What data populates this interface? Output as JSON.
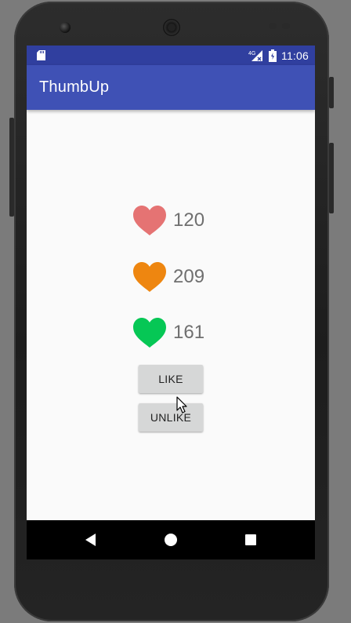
{
  "status_bar": {
    "time": "11:06",
    "network_label": "4G",
    "icons": [
      "sd-card-icon",
      "cell-signal-4g-icon",
      "battery-icon"
    ]
  },
  "app_bar": {
    "title": "ThumbUp"
  },
  "hearts": [
    {
      "count": "120",
      "color": "#e57373",
      "icon": "heart-icon"
    },
    {
      "count": "209",
      "color": "#ee8610",
      "icon": "heart-icon"
    },
    {
      "count": "161",
      "color": "#06c755",
      "icon": "heart-icon"
    }
  ],
  "buttons": {
    "like_label": "LIKE",
    "unlike_label": "UNLIKE"
  },
  "colors": {
    "status_bar": "#303f9f",
    "app_bar": "#3f51b5",
    "background": "#fafafa",
    "button": "#d6d7d7"
  },
  "navigation": {
    "icons": [
      "back-icon",
      "home-icon",
      "recents-icon"
    ]
  }
}
